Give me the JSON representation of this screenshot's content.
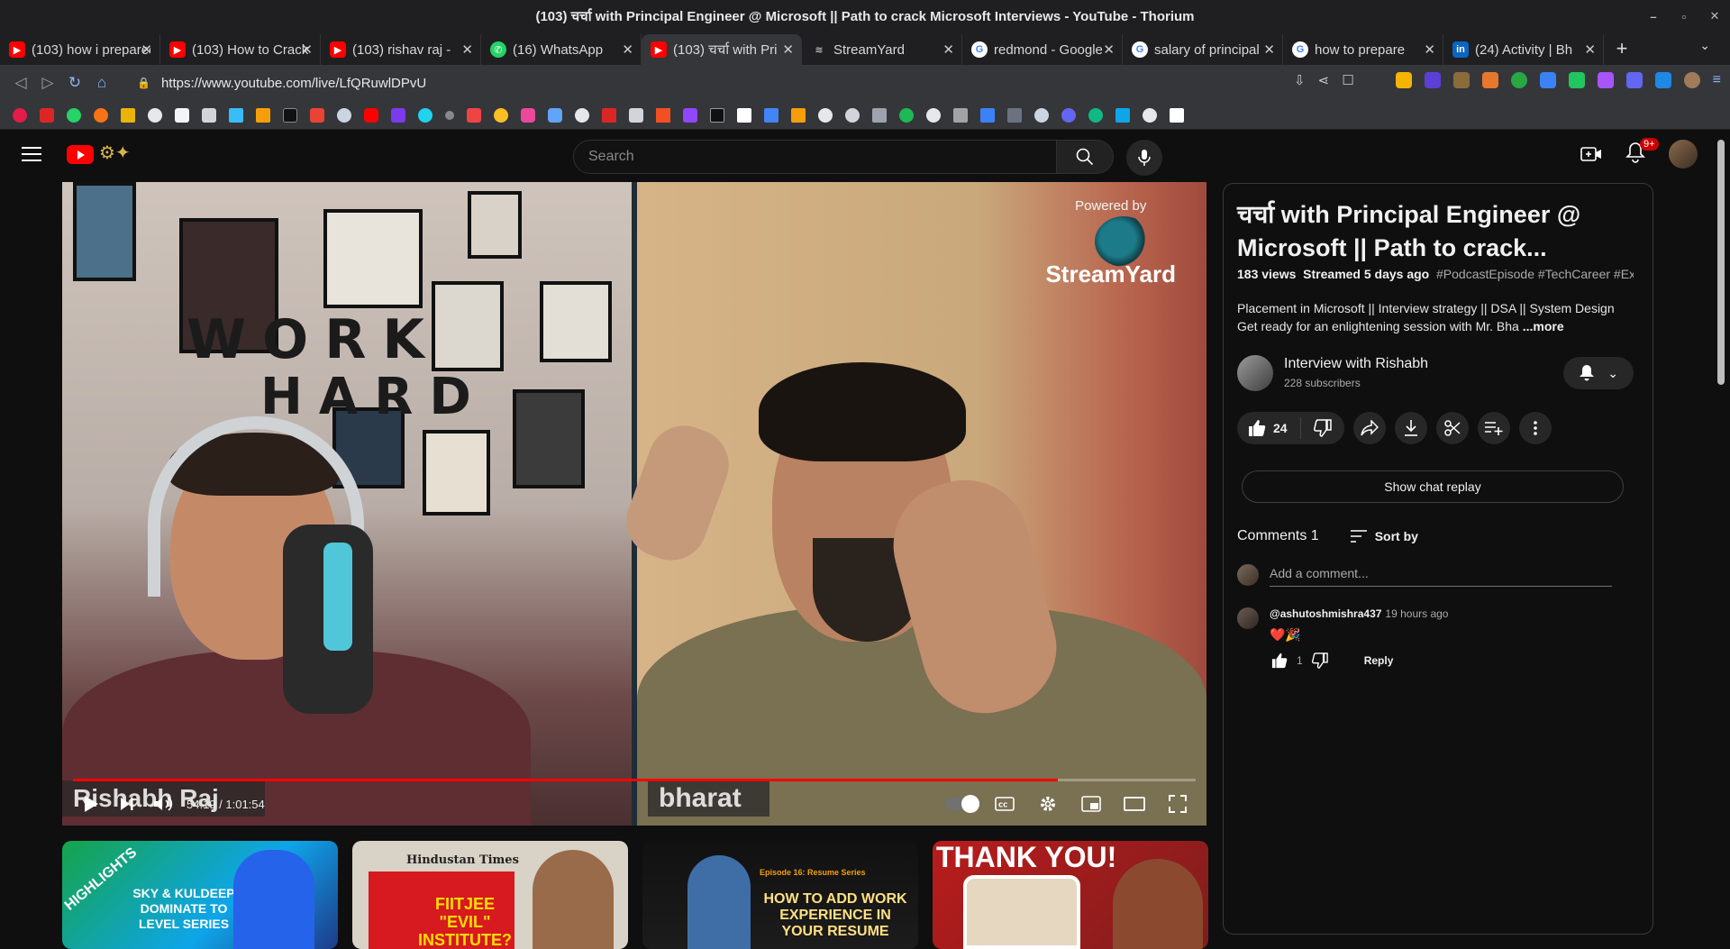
{
  "window": {
    "title": "(103) चर्चा with Principal Engineer @ Microsoft || Path to crack Microsoft Interviews - YouTube - Thorium",
    "controls": [
      "–",
      "▫",
      "✕"
    ]
  },
  "tabs": [
    {
      "label": "(103) how i prepared",
      "icon": "youtube-icon"
    },
    {
      "label": "(103) How to Crack",
      "icon": "youtube-icon"
    },
    {
      "label": "(103) rishav raj - ",
      "icon": "youtube-icon"
    },
    {
      "label": "(16) WhatsApp",
      "icon": "whatsapp-icon"
    },
    {
      "label": "(103) चर्चा with Pri",
      "icon": "youtube-icon",
      "active": true
    },
    {
      "label": "StreamYard",
      "icon": "streamyard-icon"
    },
    {
      "label": "redmond - Google",
      "icon": "google-icon"
    },
    {
      "label": "salary of principal",
      "icon": "google-icon"
    },
    {
      "label": "how to prepare",
      "icon": "google-icon"
    },
    {
      "label": "(24) Activity | Bh",
      "icon": "linkedin-icon"
    }
  ],
  "tab_close": "✕",
  "new_tab": "+",
  "address": {
    "url": "https://www.youtube.com/live/LfQRuwlDPvU"
  },
  "youtube": {
    "search_placeholder": "Search",
    "notifications": "9+"
  },
  "video": {
    "wall_word_1": "WORK",
    "wall_word_2": "HARD",
    "left_name": "Rishabh Raj",
    "right_name": "bharat",
    "powered_by": "Powered by",
    "brand": "StreamYard",
    "time": "54:19 / 1:01:54",
    "progress": 0.877
  },
  "recommendations": [
    {
      "text": "HIGHLIGHTS",
      "sub": "SKY & KULDEEP DOMINATE TO LEVEL SERIES"
    },
    {
      "text": "Hindustan Times",
      "sub": "FIITJEE \"EVIL\" INSTITUTE?"
    },
    {
      "text": "Episode 16: Resume Series",
      "sub": "HOW TO ADD WORK EXPERIENCE IN YOUR RESUME"
    },
    {
      "text": "THANK YOU!",
      "sub": ""
    }
  ],
  "details": {
    "title": "चर्चा with Principal Engineer @ Microsoft || Path to crack...",
    "views": "183 views",
    "streamed": "Streamed 5 days ago",
    "tags": "#PodcastEpisode #TechCareer #Ex",
    "desc_line1": "Placement in Microsoft || Interview strategy || DSA || System Design",
    "desc_line2": "Get ready for an enlightening session with Mr. Bha",
    "more": "...more",
    "channel": "Interview with Rishabh",
    "subscribers": "228 subscribers",
    "likes": "24",
    "chat_replay": "Show chat replay",
    "comments_label": "Comments 1",
    "sort_by": "Sort by",
    "add_comment": "Add a comment...",
    "comment": {
      "author": "@ashutoshmishra437",
      "time": "19 hours ago",
      "text": "❤️🎉",
      "likes": "1",
      "reply": "Reply"
    }
  },
  "colors": {
    "accent": "#ff0000",
    "bg": "#0f0f0f",
    "chrome": "#35363a"
  }
}
